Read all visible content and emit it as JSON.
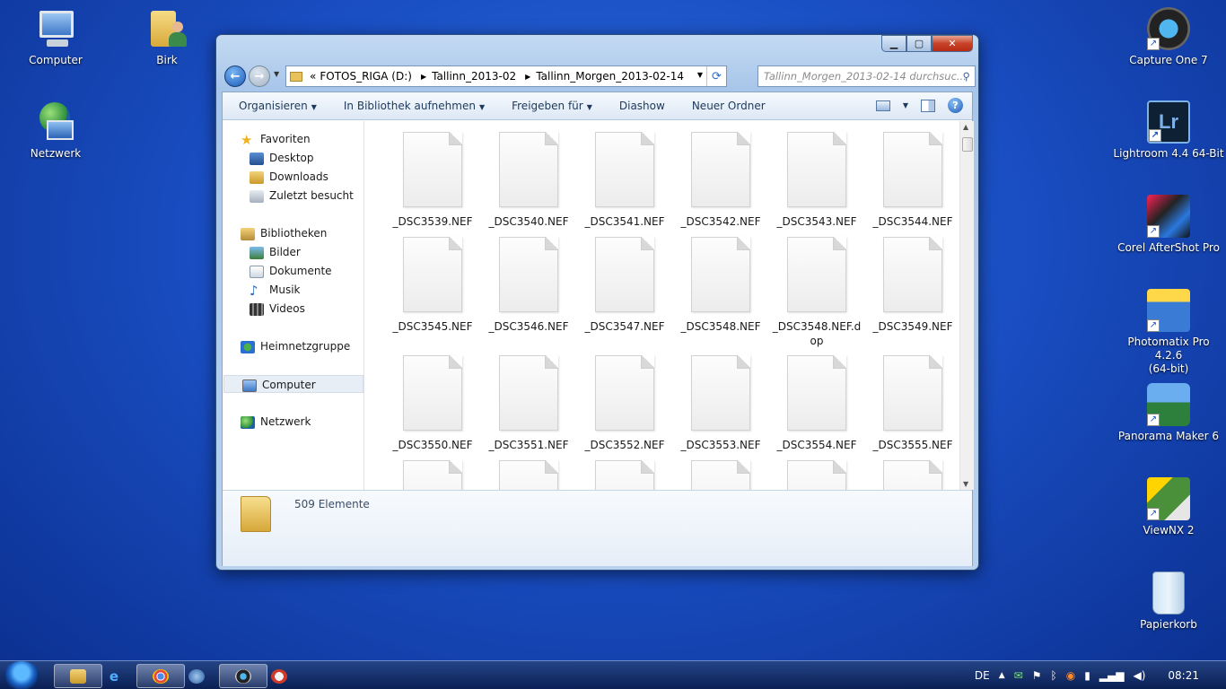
{
  "desktop": {
    "left_icons": [
      {
        "label": "Computer",
        "icon": "computer-icon"
      },
      {
        "label": "Birk",
        "icon": "user-folder-icon"
      },
      {
        "label": "Netzwerk",
        "icon": "network-icon"
      }
    ],
    "right_icons": [
      {
        "label": "Capture One 7",
        "icon": "capture-one-icon"
      },
      {
        "label": "Lightroom 4.4 64-Bit",
        "icon": "lightroom-icon",
        "glyph": "Lr"
      },
      {
        "label": "Corel AfterShot Pro",
        "icon": "aftershot-icon"
      },
      {
        "label": "Photomatix Pro 4.2.6",
        "label2": "(64-bit)",
        "icon": "photomatix-icon"
      },
      {
        "label": "Panorama Maker 6",
        "icon": "panorama-maker-icon"
      },
      {
        "label": "ViewNX 2",
        "icon": "viewnx-icon"
      },
      {
        "label": "Papierkorb",
        "icon": "recycle-bin-icon"
      }
    ]
  },
  "window": {
    "controls": {
      "minimize": "▁",
      "maximize": "▢",
      "close": "✕"
    },
    "address": {
      "prefix": "«",
      "crumbs": [
        "FOTOS_RIGA (D:)",
        "Tallinn_2013-02",
        "Tallinn_Morgen_2013-02-14"
      ]
    },
    "search_placeholder": "Tallinn_Morgen_2013-02-14 durchsuc...",
    "toolbar": {
      "organize": "Organisieren",
      "add_library": "In Bibliothek aufnehmen",
      "share": "Freigeben für",
      "slideshow": "Diashow",
      "new_folder": "Neuer Ordner",
      "help": "?"
    },
    "navigation": {
      "favorites": "Favoriten",
      "desktop": "Desktop",
      "downloads": "Downloads",
      "recent": "Zuletzt besucht",
      "libraries": "Bibliotheken",
      "pictures": "Bilder",
      "documents": "Dokumente",
      "music": "Musik",
      "videos": "Videos",
      "homegroup": "Heimnetzgruppe",
      "computer": "Computer",
      "network": "Netzwerk"
    },
    "files": [
      "_DSC3539.NEF",
      "_DSC3540.NEF",
      "_DSC3541.NEF",
      "_DSC3542.NEF",
      "_DSC3543.NEF",
      "_DSC3544.NEF",
      "_DSC3545.NEF",
      "_DSC3546.NEF",
      "_DSC3547.NEF",
      "_DSC3548.NEF",
      "_DSC3548.NEF.dop",
      "_DSC3549.NEF",
      "_DSC3550.NEF",
      "_DSC3551.NEF",
      "_DSC3552.NEF",
      "_DSC3553.NEF",
      "_DSC3554.NEF",
      "_DSC3555.NEF",
      "",
      "",
      "",
      "",
      "",
      ""
    ],
    "status": {
      "item_count": "509 Elemente"
    }
  },
  "taskbar": {
    "language": "DE",
    "clock": "08:21"
  }
}
